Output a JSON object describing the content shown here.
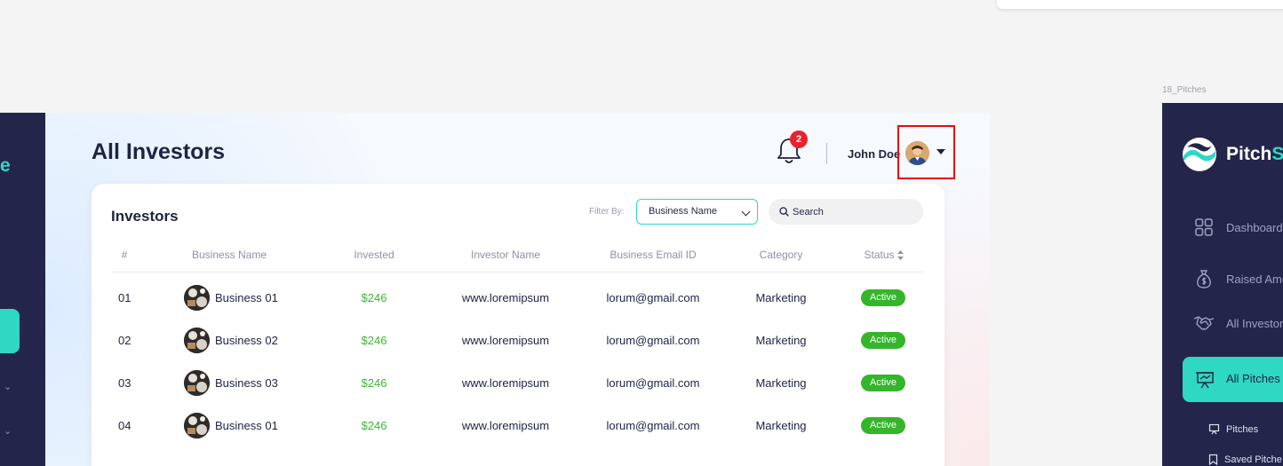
{
  "colors": {
    "accent": "#2fd8c3",
    "sidebar": "#24254a",
    "status_active": "#34b52a",
    "invested_green": "#3cb534",
    "badge_red": "#e8232b",
    "highlight_red": "#e30b0b"
  },
  "left_sidebar": {
    "logo_fragment": "e"
  },
  "header": {
    "title": "All Investors",
    "notification_count": "2",
    "user_name": "John Doe"
  },
  "investors_card": {
    "title": "Investors",
    "filter_label": "Filter By:",
    "filter_value": "Business Name",
    "search_placeholder": "Search"
  },
  "table": {
    "columns": [
      "#",
      "Business Name",
      "Invested",
      "Investor Name",
      "Business Email ID",
      "Category",
      "Status"
    ],
    "rows": [
      {
        "num": "01",
        "business": "Business 01",
        "invested": "$246",
        "investor": "www.loremipsum",
        "email": "lorum@gmail.com",
        "category": "Marketing",
        "status": "Active"
      },
      {
        "num": "02",
        "business": "Business 02",
        "invested": "$246",
        "investor": "www.loremipsum",
        "email": "lorum@gmail.com",
        "category": "Marketing",
        "status": "Active"
      },
      {
        "num": "03",
        "business": "Business 03",
        "invested": "$246",
        "investor": "www.loremipsum",
        "email": "lorum@gmail.com",
        "category": "Marketing",
        "status": "Active"
      },
      {
        "num": "04",
        "business": "Business 01",
        "invested": "$246",
        "investor": "www.loremipsum",
        "email": "lorum@gmail.com",
        "category": "Marketing",
        "status": "Active"
      }
    ]
  },
  "right_artboard": {
    "label": "18_Pitches",
    "brand_main": "Pitch",
    "brand_accent": "S",
    "nav": [
      {
        "label": "Dashboard",
        "icon": "grid-icon"
      },
      {
        "label": "Raised Amo",
        "icon": "money-bag-icon"
      },
      {
        "label": "All Investor",
        "icon": "handshake-icon"
      }
    ],
    "active_item": "All Pitches",
    "sub_items": [
      "Pitches",
      "Saved Pitche"
    ]
  }
}
